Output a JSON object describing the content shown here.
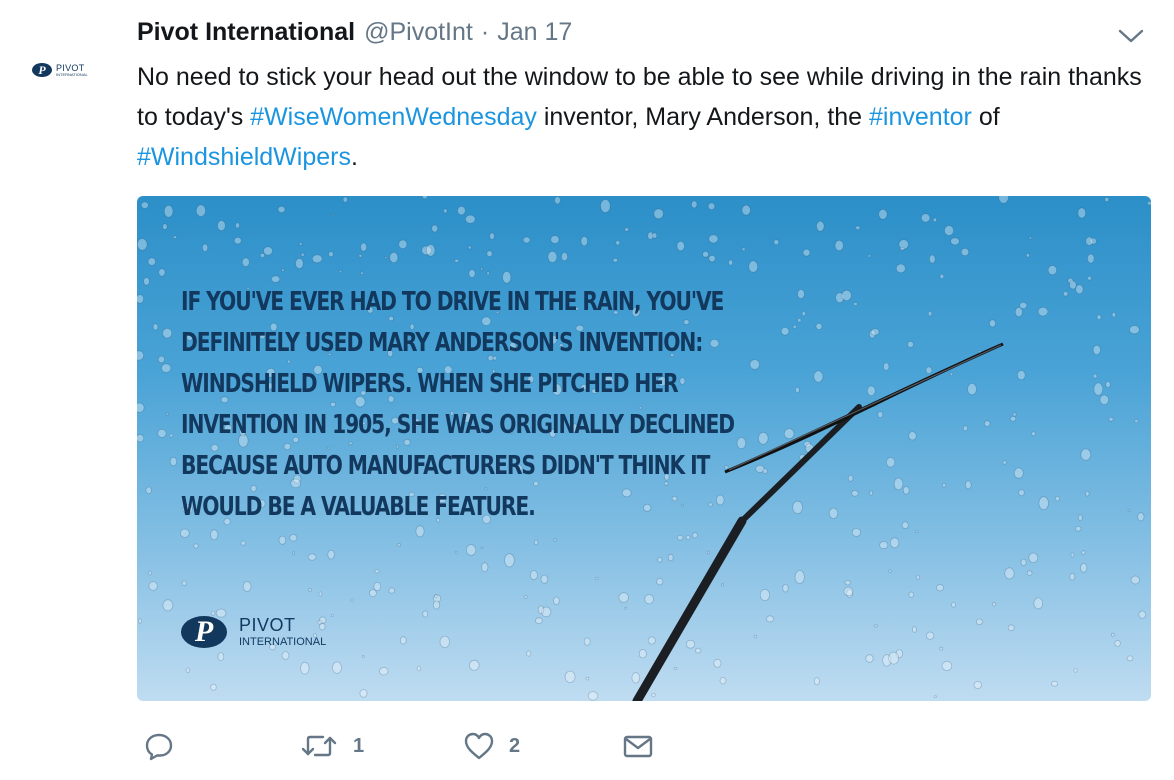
{
  "tweet": {
    "author_name": "Pivot International",
    "handle": "@PivotInt",
    "separator": "·",
    "date": "Jan 17",
    "avatar_title": "PIVOT",
    "avatar_subtitle": "INTERNATIONAL",
    "text_parts": [
      {
        "text": "No need to stick your head out the window to be able to see while driving in the rain thanks to today's ",
        "type": "plain"
      },
      {
        "text": "#WiseWomenWednesday",
        "type": "hashtag"
      },
      {
        "text": " inventor, Mary Anderson, the ",
        "type": "plain"
      },
      {
        "text": "#inventor",
        "type": "hashtag"
      },
      {
        "text": " of ",
        "type": "plain"
      },
      {
        "text": "#WindshieldWipers",
        "type": "hashtag"
      },
      {
        "text": ".",
        "type": "plain"
      }
    ]
  },
  "media": {
    "quote": "If you've ever had to drive in the rain, you've definitely used Mary Anderson's invention: windshield wipers. When she pitched her invention in 1905, she was originally declined because auto manufacturers didn't think it would be a valuable feature.",
    "logo_title": "PIVOT",
    "logo_subtitle": "INTERNATIONAL"
  },
  "actions": {
    "reply": {
      "icon": "reply-icon",
      "count": ""
    },
    "retweet": {
      "icon": "retweet-icon",
      "count": "1"
    },
    "like": {
      "icon": "heart-icon",
      "count": "2"
    },
    "message": {
      "icon": "envelope-icon",
      "count": ""
    }
  },
  "colors": {
    "hashtag": "#1b95e0",
    "meta": "#657786",
    "brand_navy": "#12385e"
  }
}
